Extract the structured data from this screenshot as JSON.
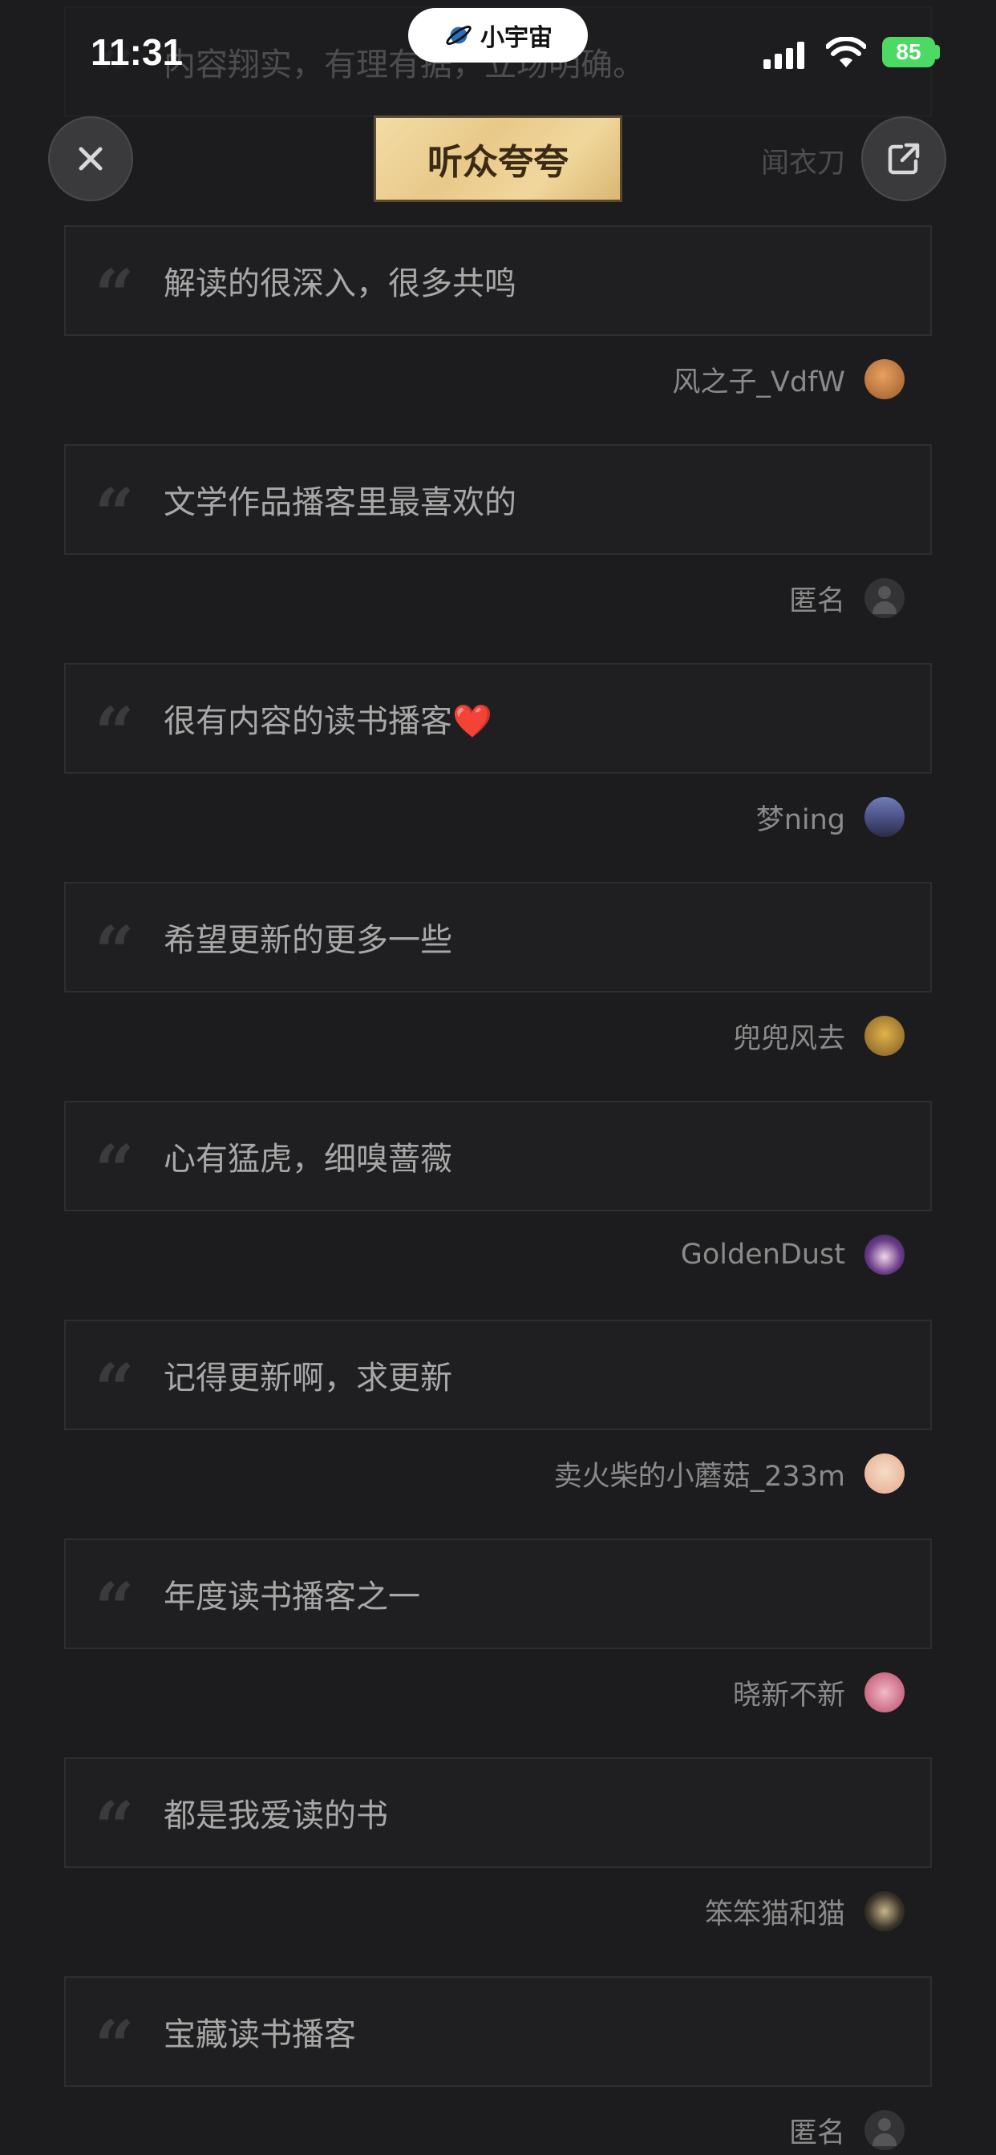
{
  "status_bar": {
    "time": "11:31",
    "app_name": "小宇宙",
    "battery": "85"
  },
  "header": {
    "title": "听众夸夸",
    "close_icon": "close-icon",
    "share_icon": "share-icon"
  },
  "comments": [
    {
      "text": "内容翔实，有理有据，立场明确。",
      "author": "闻衣刀",
      "avatar": "photo-dark"
    },
    {
      "text": "解读的很深入，很多共鸣",
      "author": "风之子_VdfW",
      "avatar": "photo-orange"
    },
    {
      "text": "文学作品播客里最喜欢的",
      "author": "匿名",
      "avatar": "anonymous"
    },
    {
      "text": "很有内容的读书播客❤️",
      "author": "梦ning",
      "avatar": "photo-dusk"
    },
    {
      "text": "希望更新的更多一些",
      "author": "兜兜风去",
      "avatar": "photo-gold"
    },
    {
      "text": "心有猛虎，细嗅蔷薇",
      "author": "GoldenDust",
      "avatar": "photo-anime"
    },
    {
      "text": "记得更新啊，求更新",
      "author": "卖火柴的小蘑菇_233m",
      "avatar": "photo-peach"
    },
    {
      "text": "年度读书播客之一",
      "author": "晓新不新",
      "avatar": "photo-pink"
    },
    {
      "text": "都是我爱读的书",
      "author": "笨笨猫和猫",
      "avatar": "photo-cat"
    },
    {
      "text": "宝藏读书播客",
      "author": "匿名",
      "avatar": "anonymous"
    }
  ],
  "colors": {
    "background": "#1c1c1e",
    "card_border": "#2e2e31",
    "text": "#a8a8a8",
    "author": "#8a8a8a",
    "banner": "#f1d79c",
    "battery": "#4cd964"
  }
}
